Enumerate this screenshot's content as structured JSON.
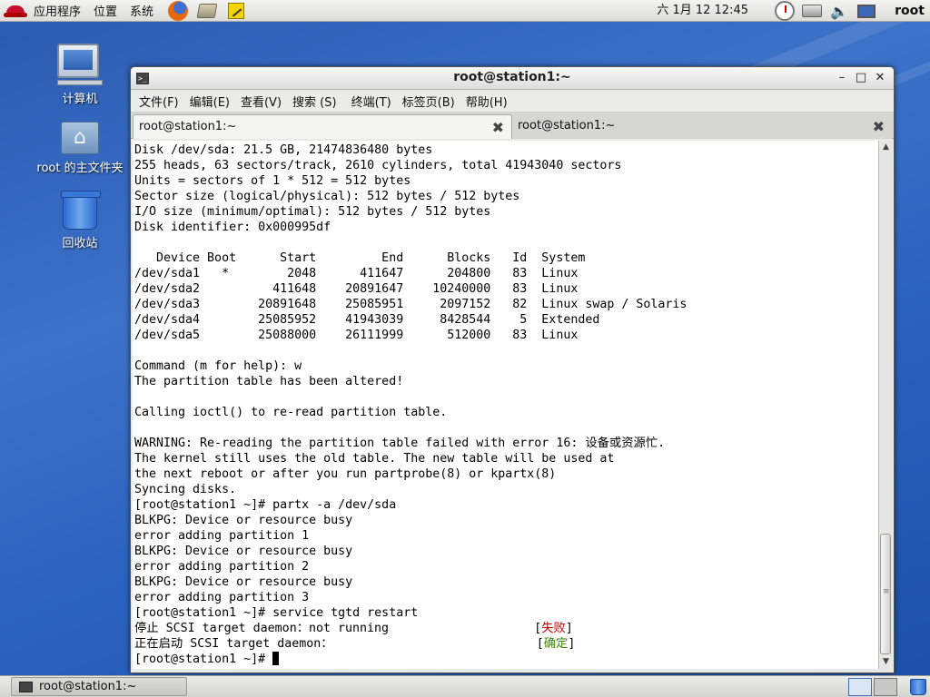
{
  "top_panel": {
    "menus": [
      "应用程序",
      "位置",
      "系统"
    ],
    "clock": "六  1月 12 12:45",
    "user": "root",
    "launchers": [
      "firefox-icon",
      "system-tools-icon",
      "notes-icon"
    ],
    "tray": [
      "clock-applet-icon",
      "network-icon",
      "volume-icon",
      "display-icon"
    ]
  },
  "desktop": {
    "icons": [
      {
        "label": "计算机",
        "icon": "computer-icon"
      },
      {
        "label": "root 的主文件夹",
        "icon": "home-folder-icon"
      },
      {
        "label": "回收站",
        "icon": "trash-icon"
      }
    ]
  },
  "window": {
    "title": "root@station1:~",
    "menubar": [
      "文件(F)",
      "编辑(E)",
      "查看(V)",
      "搜索 (S)",
      "终端(T)",
      "标签页(B)",
      "帮助(H)"
    ],
    "tabs": [
      {
        "label": "root@station1:~",
        "active": true
      },
      {
        "label": "root@station1:~",
        "active": false
      }
    ],
    "terminal_lines": [
      "Disk /dev/sda: 21.5 GB, 21474836480 bytes",
      "255 heads, 63 sectors/track, 2610 cylinders, total 41943040 sectors",
      "Units = sectors of 1 * 512 = 512 bytes",
      "Sector size (logical/physical): 512 bytes / 512 bytes",
      "I/O size (minimum/optimal): 512 bytes / 512 bytes",
      "Disk identifier: 0x000995df",
      "",
      "   Device Boot      Start         End      Blocks   Id  System",
      "/dev/sda1   *        2048      411647      204800   83  Linux",
      "/dev/sda2          411648    20891647    10240000   83  Linux",
      "/dev/sda3        20891648    25085951     2097152   82  Linux swap / Solaris",
      "/dev/sda4        25085952    41943039     8428544    5  Extended",
      "/dev/sda5        25088000    26111999      512000   83  Linux",
      "",
      "Command (m for help): w",
      "The partition table has been altered!",
      "",
      "Calling ioctl() to re-read partition table.",
      "",
      "WARNING: Re-reading the partition table failed with error 16: 设备或资源忙.",
      "The kernel still uses the old table. The new table will be used at",
      "the next reboot or after you run partprobe(8) or kpartx(8)",
      "Syncing disks.",
      "[root@station1 ~]# partx -a /dev/sda",
      "BLKPG: Device or resource busy",
      "error adding partition 1",
      "BLKPG: Device or resource busy",
      "error adding partition 2",
      "BLKPG: Device or resource busy",
      "error adding partition 3",
      "[root@station1 ~]# service tgtd restart"
    ],
    "service_lines": [
      {
        "text": "停止 SCSI target daemon：not running                    ",
        "status": "失败"
      },
      {
        "text": "正在启动 SCSI target daemon：                            ",
        "status": "确定"
      }
    ],
    "prompt": "[root@station1 ~]# "
  },
  "bottom_panel": {
    "task": "root@station1:~"
  }
}
